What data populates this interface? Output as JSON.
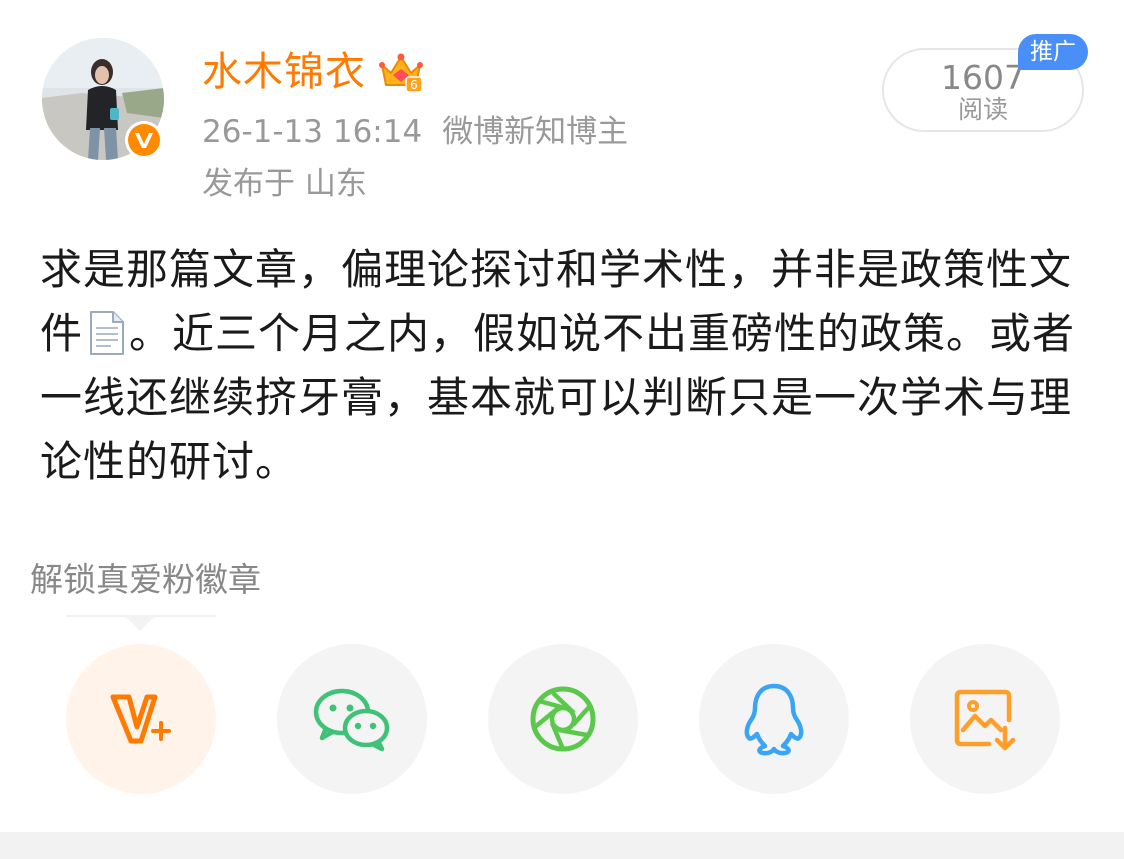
{
  "post": {
    "author": {
      "name": "水木锦衣",
      "verified_icon": "orange-verified-v-icon",
      "member_icon": "crown-member-icon",
      "member_level": "6"
    },
    "timestamp": "26-1-13 16:14",
    "author_tag": "微博新知博主",
    "location": "发布于 山东",
    "read_count": "1607",
    "read_label": "阅读",
    "promo_tag": "推广",
    "body_before_icon": "求是那篇文章，偏理论探讨和学术性，并非是政策性文件",
    "body_icon": "document-icon",
    "body_after_icon": "。近三个月之内，假如说不出重磅性的政策。或者一线还继续挤牙膏，基本就可以判断只是一次学术与理论性的研讨。"
  },
  "fan_badge": {
    "label": "解锁真爱粉徽章"
  },
  "share": {
    "buttons": [
      {
        "id": "vplus",
        "icon": "v-plus-icon"
      },
      {
        "id": "wechat",
        "icon": "wechat-icon"
      },
      {
        "id": "moments",
        "icon": "moments-aperture-icon"
      },
      {
        "id": "qq",
        "icon": "qq-penguin-icon"
      },
      {
        "id": "save",
        "icon": "save-image-icon"
      }
    ]
  },
  "colors": {
    "accent_orange": "#ff7a00",
    "meta_gray": "#999999",
    "promo_blue": "#4a8ff7",
    "wechat_green": "#3fc177",
    "moments_green": "#5bc84c",
    "qq_blue": "#3ba5f5"
  }
}
